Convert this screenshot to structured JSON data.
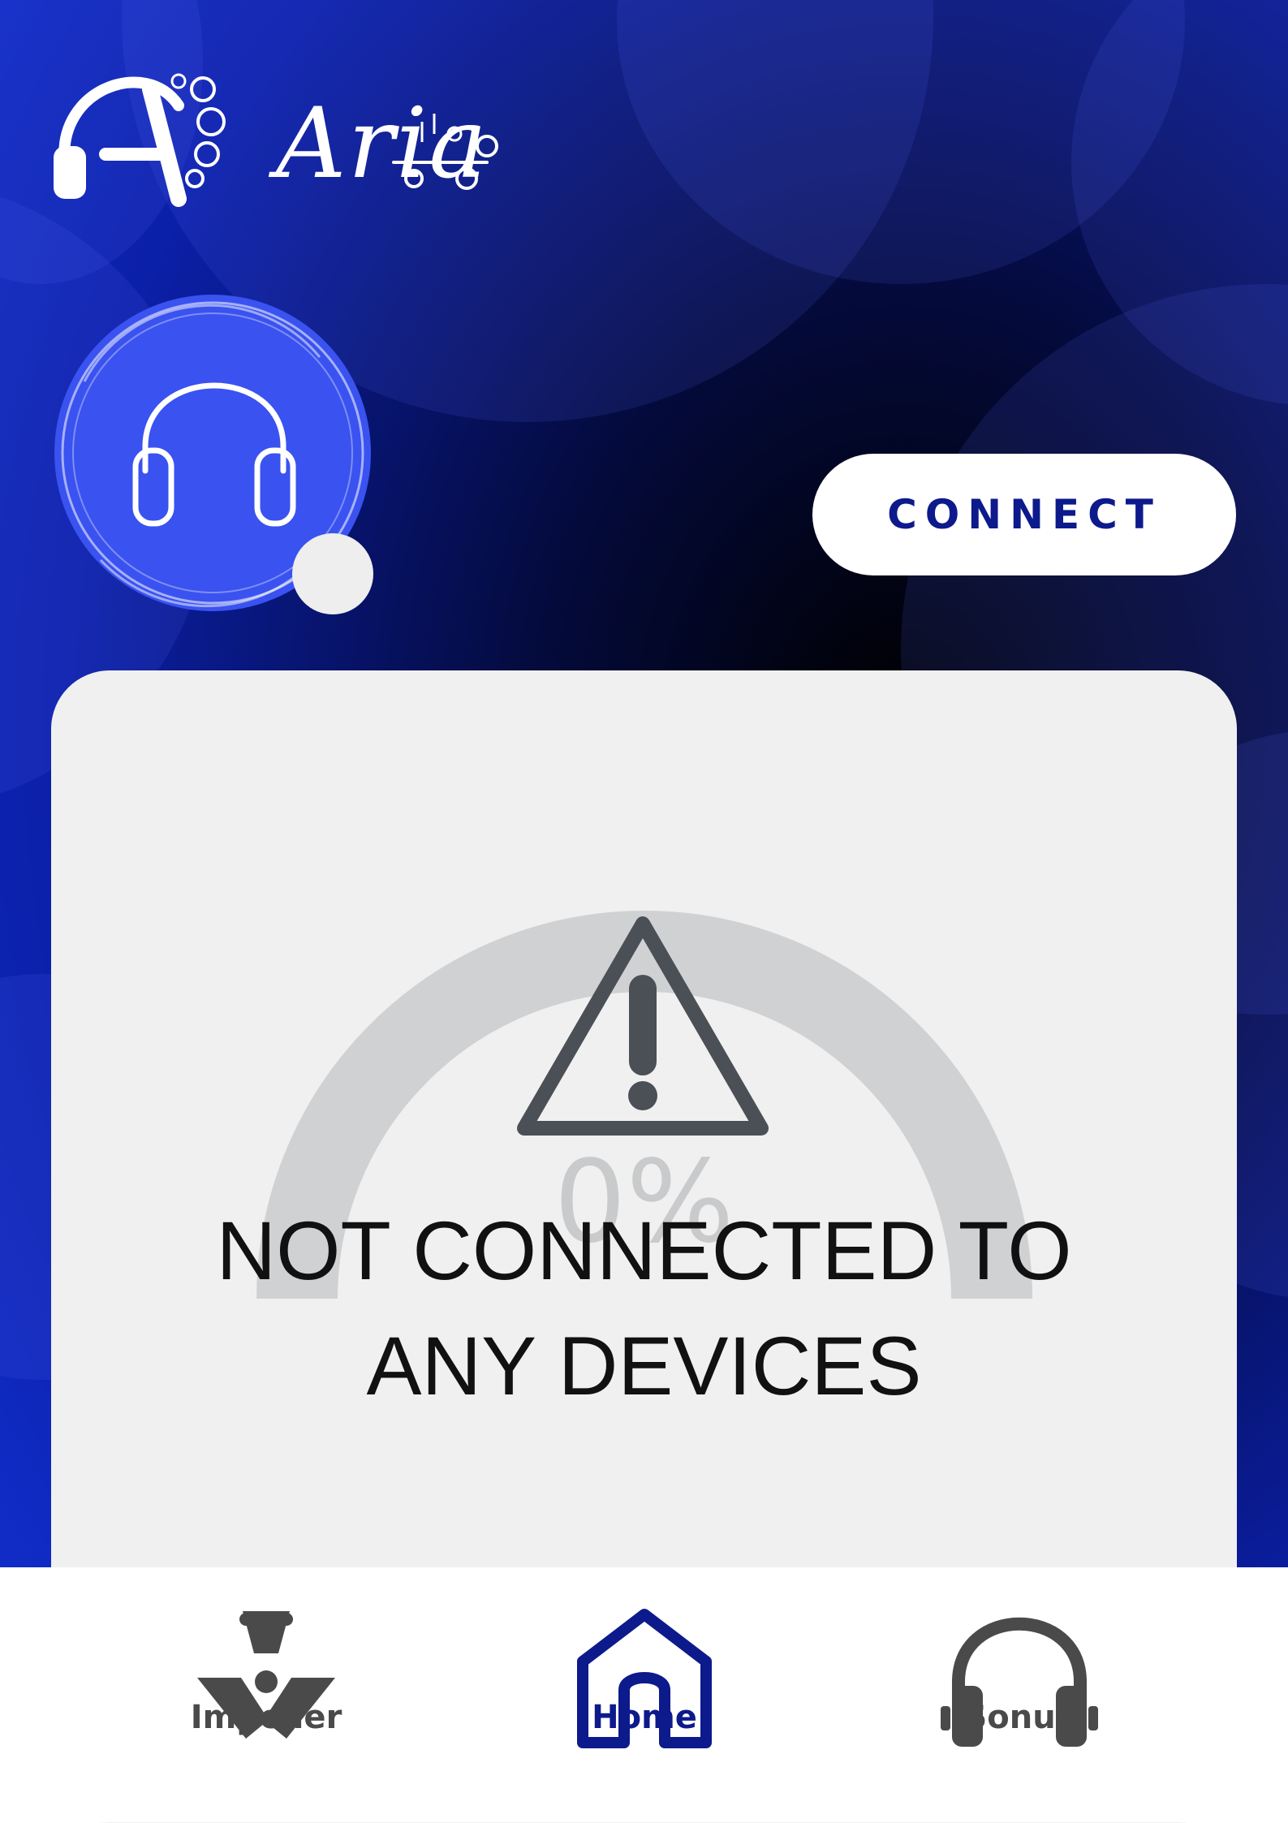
{
  "app": {
    "name": "Aria"
  },
  "colors": {
    "accent": "#0d1a8c",
    "avatar": "#3a52f0",
    "card": "#f0f0f0",
    "gauge_track": "#d0d1d3",
    "warning": "#4b4f56",
    "tab_inactive": "#4a4a4a"
  },
  "header": {
    "connect_label": "CONNECT"
  },
  "device": {
    "icon": "headphones-icon",
    "connected": false
  },
  "gauge": {
    "value_text": "0%",
    "level": 0
  },
  "status": {
    "icon": "warning-icon",
    "message": "NOT CONNECTED TO ANY DEVICES"
  },
  "tabs": [
    {
      "label": "Impeller",
      "icon": "impeller-icon",
      "active": false
    },
    {
      "label": "Home",
      "icon": "home-icon",
      "active": true
    },
    {
      "label": "Sonus",
      "icon": "headphones-icon",
      "active": false
    }
  ]
}
